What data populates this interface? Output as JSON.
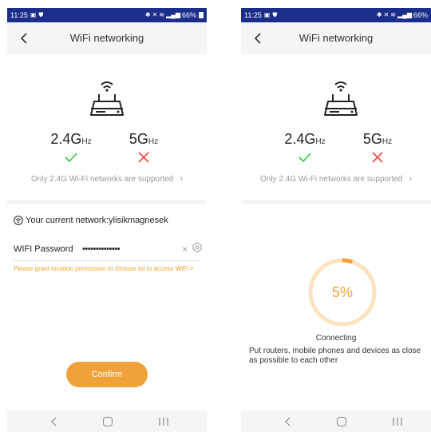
{
  "colors": {
    "status_bar": "#1b2f8a",
    "accent": "#f0a23a",
    "success": "#2ecc40",
    "error": "#e74c3c",
    "muted": "#999999"
  },
  "status_bar": {
    "time": "11:25",
    "battery": "66%",
    "icons": [
      "gallery-icon",
      "shield-icon",
      "bluetooth-icon",
      "mute-icon",
      "wifi-call-icon",
      "signal-icon"
    ]
  },
  "left": {
    "header": {
      "title": "WiFi networking"
    },
    "bands": {
      "band1": {
        "name": "2.4G",
        "unit": "Hz",
        "supported": true
      },
      "band2": {
        "name": "5G",
        "unit": "Hz",
        "supported": false
      }
    },
    "note": "Only 2.4G Wi-Fi networks are supported",
    "network_label": "Your current network:ylisikmagnesek",
    "password_label": "WIFI Password",
    "password_value": "••••••••••••••",
    "permission_text": "Please grant location permission to Xhouse lot to access WiFi >",
    "confirm_label": "Confirm"
  },
  "right": {
    "header": {
      "title": "WiFi networking"
    },
    "bands": {
      "band1": {
        "name": "2.4G",
        "unit": "Hz",
        "supported": true
      },
      "band2": {
        "name": "5G",
        "unit": "Hz",
        "supported": false
      }
    },
    "note": "Only 2.4G Wi-Fi networks are supported",
    "progress": {
      "value": 5,
      "label": "5%"
    },
    "status": "Connecting",
    "advice": "Put routers, mobile phones and devices as close as possible to each other"
  }
}
